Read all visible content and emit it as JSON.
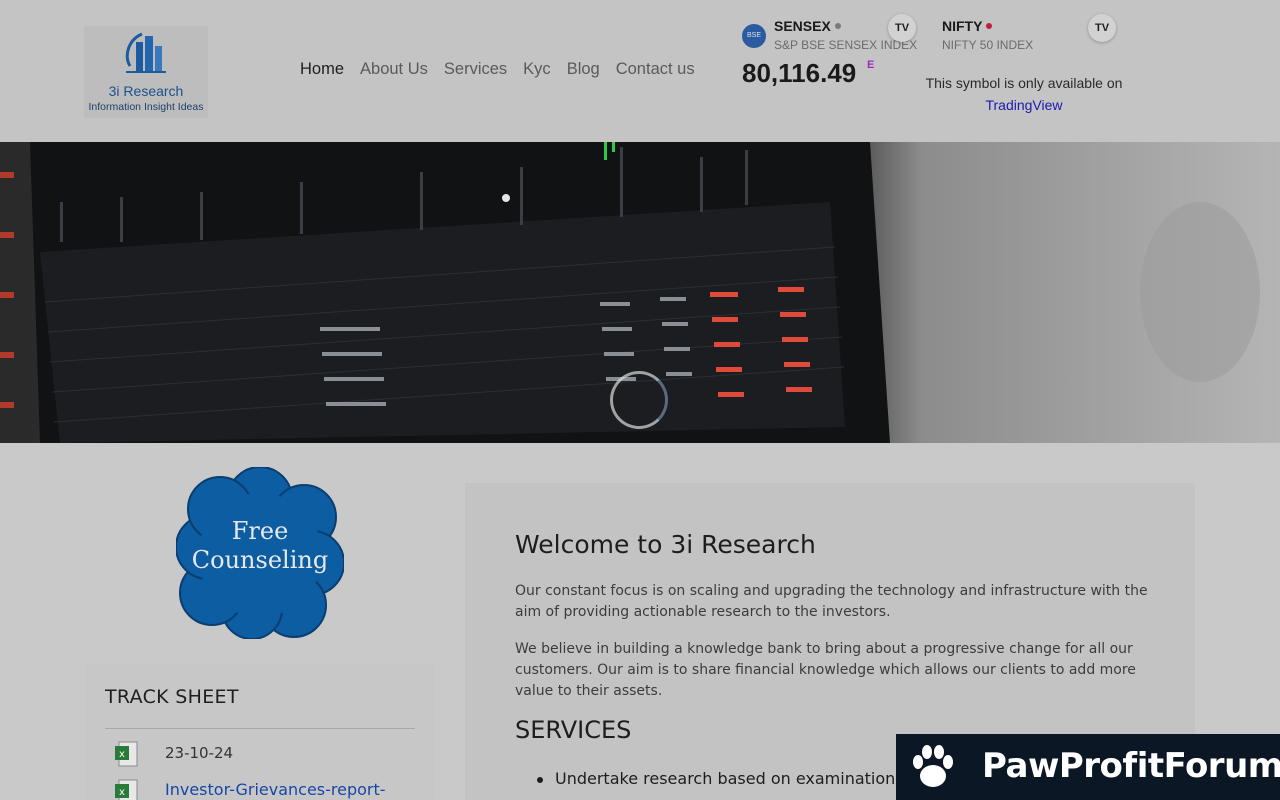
{
  "logo": {
    "name": "3i Research",
    "tagline": "Information Insight Ideas"
  },
  "nav": [
    {
      "label": "Home",
      "active": true
    },
    {
      "label": "About Us"
    },
    {
      "label": "Services"
    },
    {
      "label": "Kyc"
    },
    {
      "label": "Blog"
    },
    {
      "label": "Contact us"
    }
  ],
  "ticker_sensex": {
    "badge": "BSE",
    "symbol": "SENSEX",
    "exchange": "S&P BSE SENSEX INDEX",
    "price": "80,116.49",
    "flag": "E",
    "tv_label": "TV",
    "dot_color": "#7a7a7a"
  },
  "ticker_nifty": {
    "symbol": "NIFTY",
    "exchange": "NIFTY 50 INDEX",
    "message": "This symbol is only available on",
    "link": "TradingView",
    "tv_label": "TV",
    "dot_color": "#c0213a"
  },
  "counseling": {
    "line1": "Free",
    "line2": "Counseling"
  },
  "track_sheet": {
    "title": "TRACK SHEET",
    "date": "23-10-24",
    "link": "Investor-Grievances-report-"
  },
  "welcome": {
    "title": "Welcome to 3i Research",
    "p1": "Our constant focus is on scaling and upgrading the technology and infrastructure with the aim of providing actionable research to the investors.",
    "p2": "We believe in building a knowledge bank to bring about a progressive change for all our customers. Our aim is to share financial knowledge which allows our clients to add more value to their assets.",
    "services_heading": "SERVICES",
    "service_item": "Undertake research based on examination"
  },
  "watermark": {
    "text": "PawProfitForum"
  },
  "colors": {
    "brand_blue": "#1d5aa0",
    "counsel_blue": "#0d5da3",
    "watermark_bg": "#0c1726"
  }
}
